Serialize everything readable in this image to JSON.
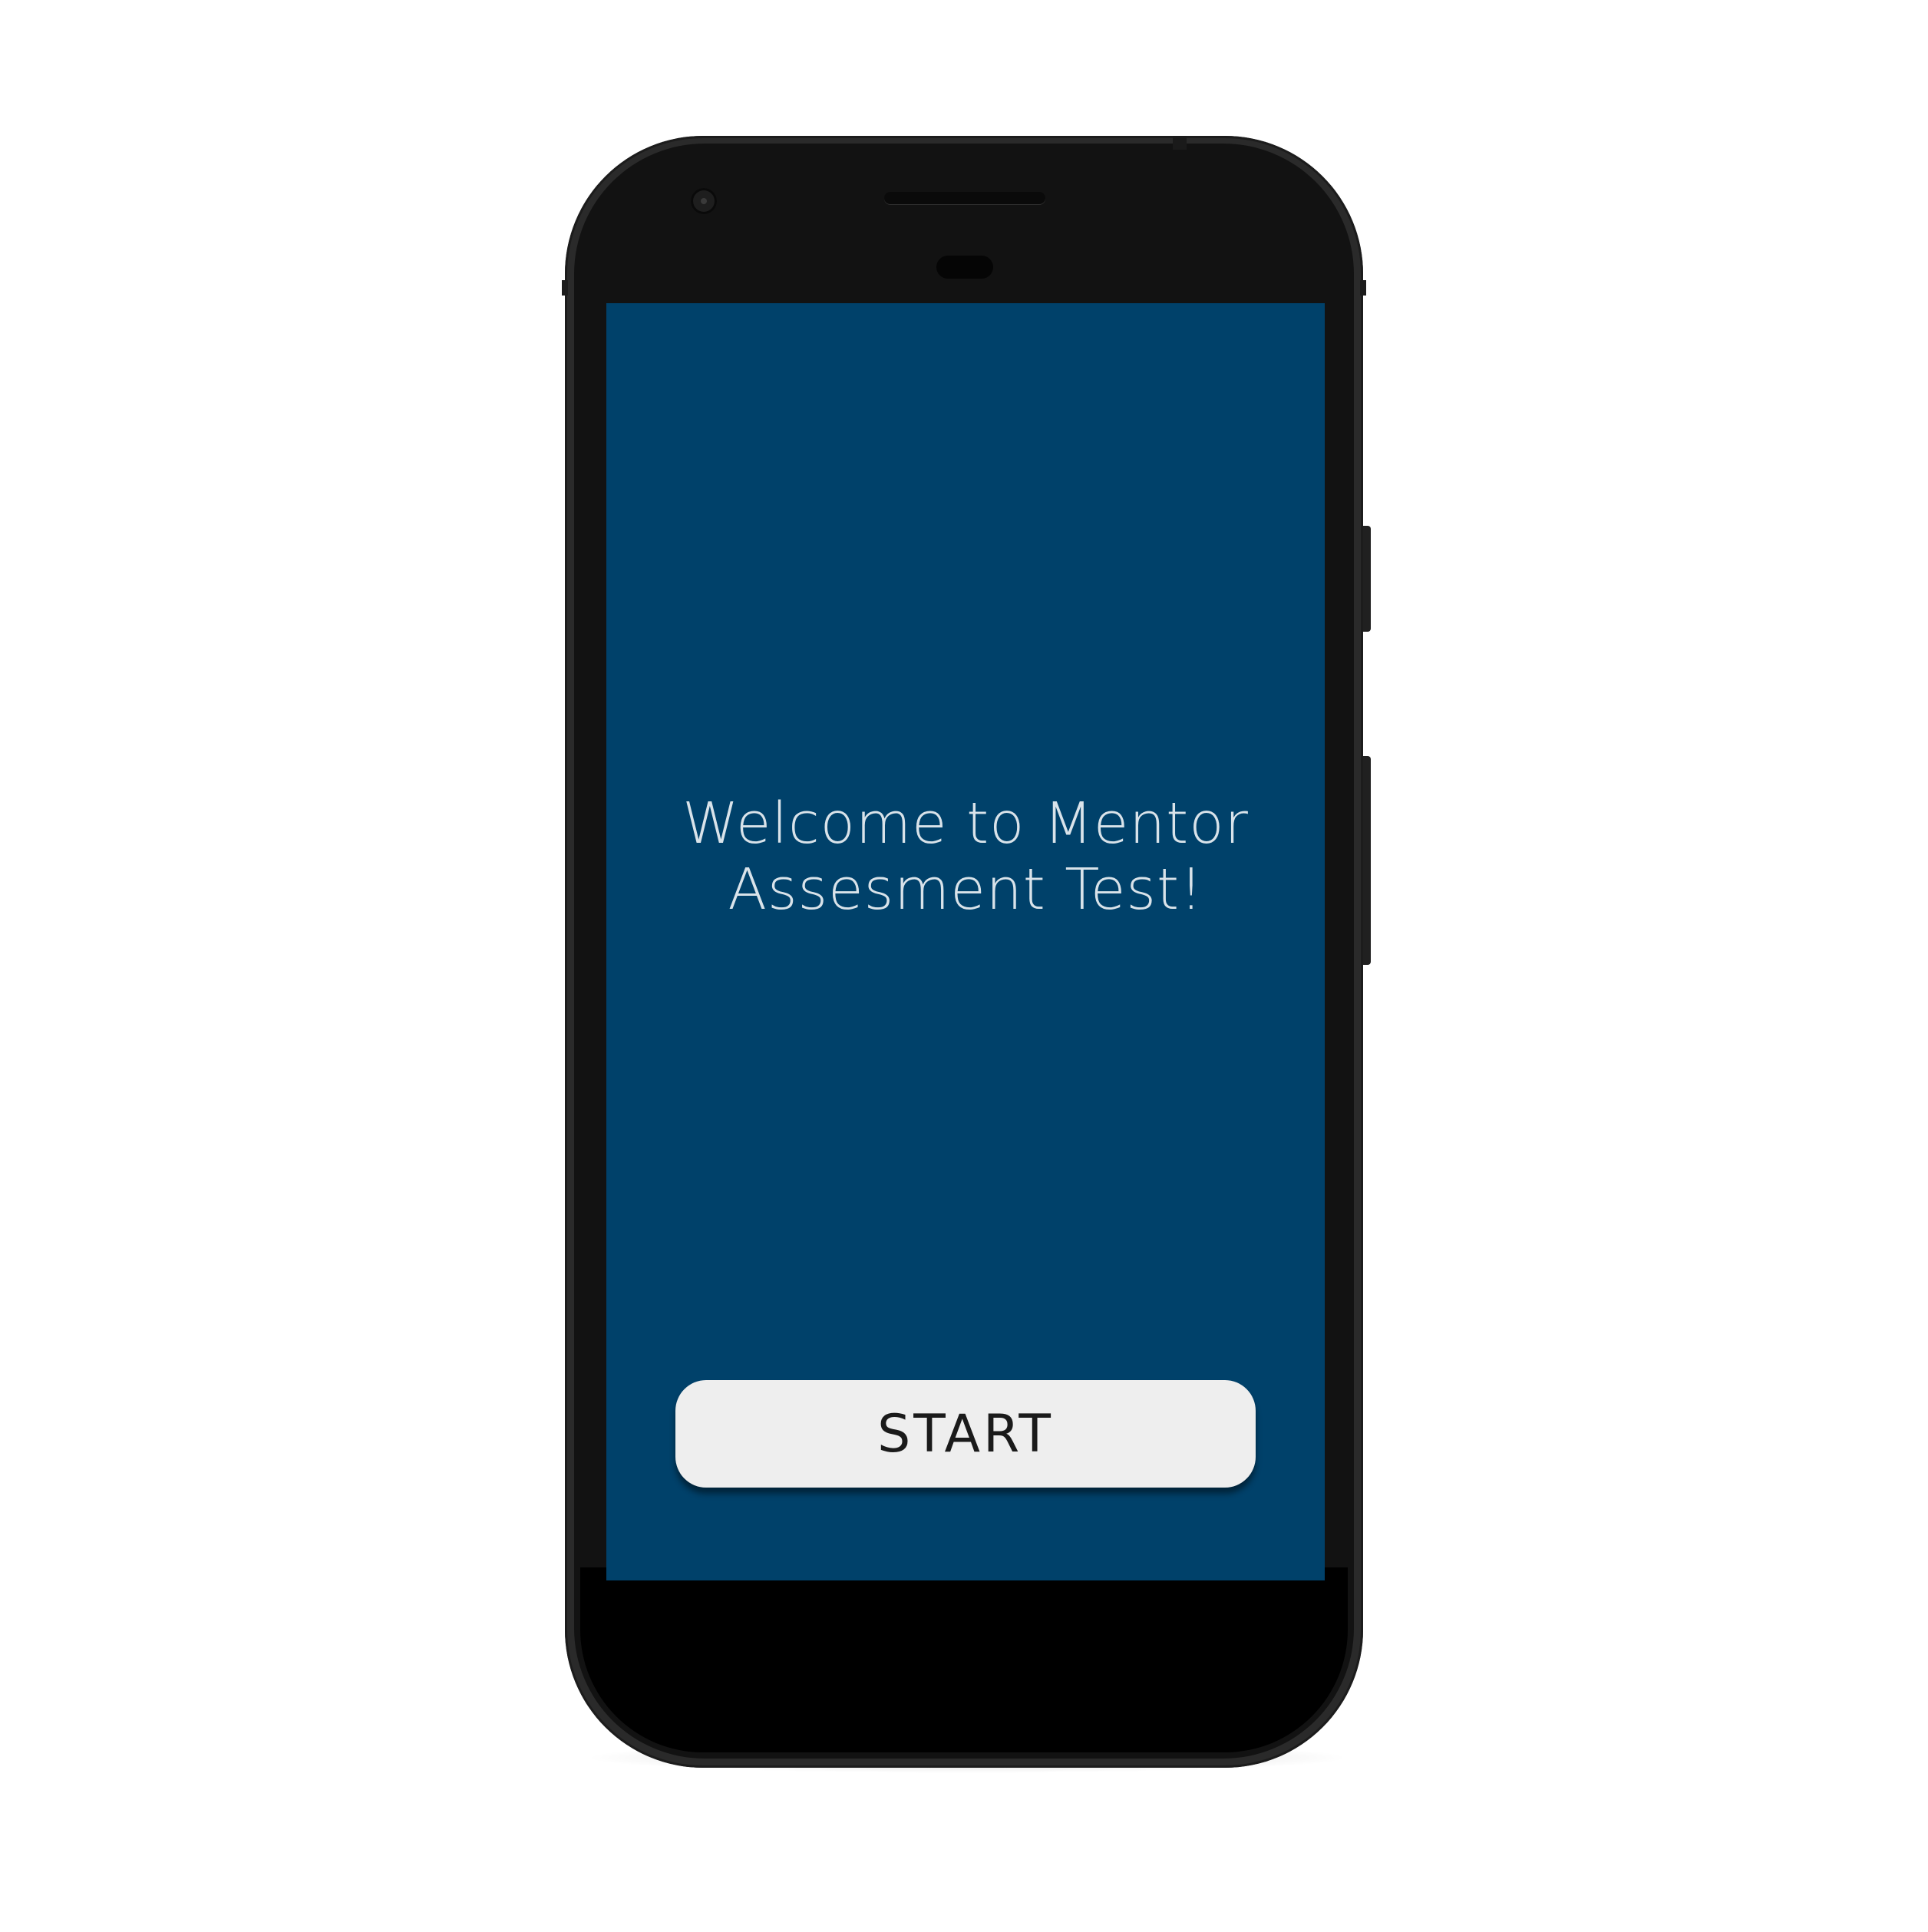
{
  "device": {
    "type": "android phone mockup",
    "screen_background": "#00416a"
  },
  "screen": {
    "welcome_line1": "Welcome to Mentor",
    "welcome_line2": "Assesment Test!",
    "start_button_label": "START"
  }
}
